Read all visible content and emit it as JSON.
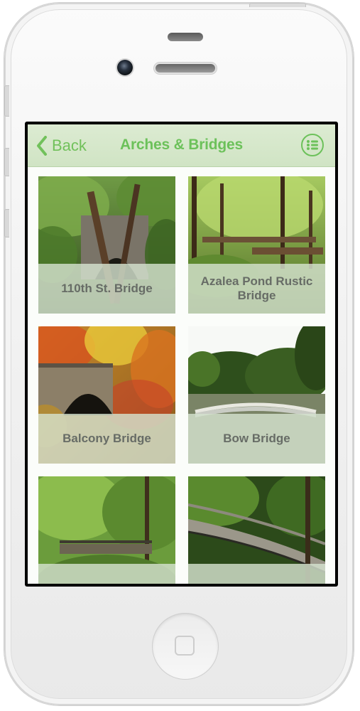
{
  "navbar": {
    "back_label": "Back",
    "title": "Arches & Bridges"
  },
  "tiles": [
    {
      "label": "110th St. Bridge"
    },
    {
      "label": "Azalea Pond Rustic Bridge"
    },
    {
      "label": "Balcony Bridge"
    },
    {
      "label": "Bow Bridge"
    },
    {
      "label": ""
    },
    {
      "label": ""
    }
  ],
  "colors": {
    "accent": "#6cc15a",
    "navbar": "#d4e7c8",
    "tile_overlay": "#d4e2ce",
    "tile_label": "#676c66"
  },
  "icons": {
    "back": "chevron-left-icon",
    "menu": "list-icon"
  }
}
